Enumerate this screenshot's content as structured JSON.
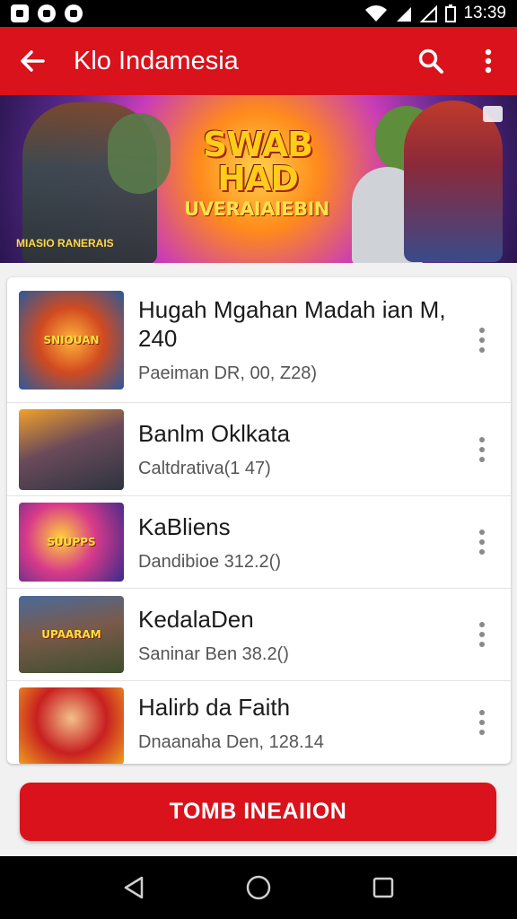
{
  "status_bar": {
    "time": "13:39"
  },
  "app_bar": {
    "title": "Klo Indamesia"
  },
  "banner": {
    "title": "SWAB\nHAD",
    "subtitle": "UVERAIAIEBIN",
    "caption": "MIASIO RANERAIS"
  },
  "items": [
    {
      "title": "Hugah Mgahan Madah ian M, 240",
      "subtitle": "Paeiman DR, 00, Z28)",
      "thumb_label": "SNIOUAN"
    },
    {
      "title": "Banlm Oklkata",
      "subtitle": "Caltdrativa(1 47)",
      "thumb_label": ""
    },
    {
      "title": "KaBliens",
      "subtitle": "Dandibioe 312.2()",
      "thumb_label": "SUUPPS"
    },
    {
      "title": "KedalaDen",
      "subtitle": "Saninar Ben 38.2()",
      "thumb_label": "UPAARAM"
    },
    {
      "title": "Halirb da Faith",
      "subtitle": "Dnaanaha Den, 128.14",
      "thumb_label": ""
    }
  ],
  "primary_button": {
    "label": "TOMB INEAIION"
  },
  "colors": {
    "brand_red": "#d9121b",
    "status_bar": "#000000",
    "nav_bar": "#000000"
  }
}
